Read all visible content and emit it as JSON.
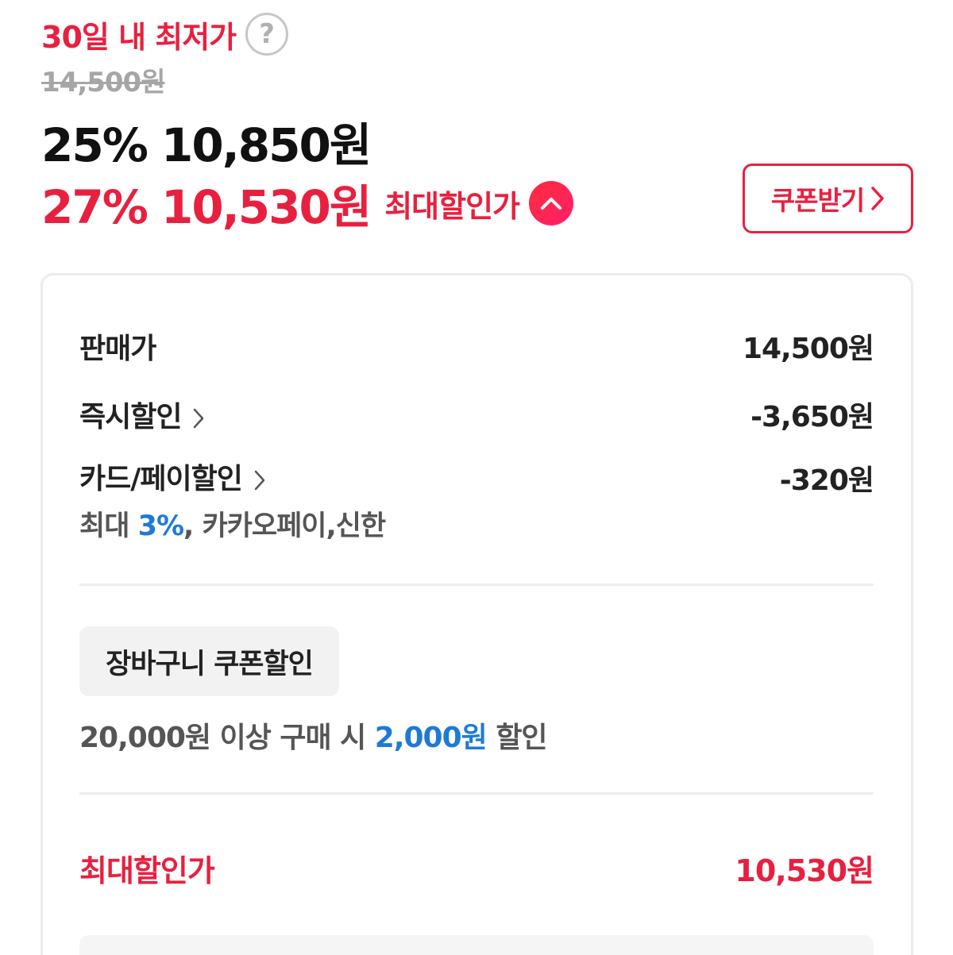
{
  "header": {
    "lowest_label": "30일 내 최저가",
    "help_icon": "question-circle-icon",
    "original_price": "14,500원",
    "sale_price": "25% 10,850원",
    "max_price": "27% 10,530원",
    "max_label": "최대할인가",
    "collapse_icon": "chevron-up-icon",
    "coupon_button": "쿠폰받기"
  },
  "breakdown": {
    "rows": [
      {
        "label": "판매가",
        "value": "14,500원"
      },
      {
        "label": "즉시할인",
        "value": "-3,650원"
      },
      {
        "label": "카드/페이할인",
        "value": "-320원"
      }
    ],
    "card_note_prefix": "최대 ",
    "card_note_highlight": "3%",
    "card_note_suffix": ", 카카오페이,신한"
  },
  "cart_coupon": {
    "chip": "장바구니 쿠폰할인",
    "desc_prefix": "20,000원 이상 구매 시 ",
    "desc_highlight": "2,000원",
    "desc_suffix": " 할인"
  },
  "final": {
    "label": "최대할인가",
    "value": "10,530원"
  },
  "colors": {
    "accent": "#e8203f",
    "blue": "#1f7ad6"
  }
}
